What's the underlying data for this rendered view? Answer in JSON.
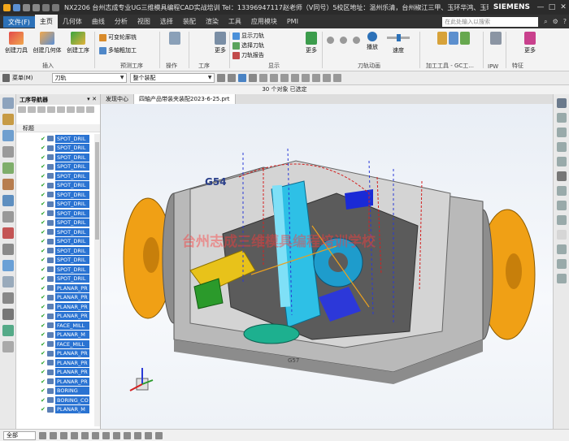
{
  "titlebar": {
    "title": "NX2206 台州志成专业UG三维模具编程CAD实战培训 Tel：13396947117赵老师（V同号）5校区地址：温州乐清，台州椒江三甲、玉环华鸿、玉环沙门，玉环坎门 - 加工",
    "brand": "SIEMENS",
    "minimize": "—",
    "maximize": "□",
    "close": "✕"
  },
  "menubar": {
    "file": "文件(F)",
    "items": [
      "主页",
      "几何体",
      "曲线",
      "分析",
      "视图",
      "选择",
      "装配",
      "渲染",
      "工具",
      "应用模块",
      "PMI"
    ],
    "active_index": 0,
    "search_placeholder": "在此处输入以搜索"
  },
  "ribbon": {
    "buttons": {
      "create_tool": "创建刀具",
      "create_geometry": "创建几何体",
      "create_operation": "创建工序",
      "variable_profile": "可变轮廓铣",
      "multiaxis_rough": "多轴粗加工",
      "more1": "更多",
      "more2": "更多",
      "show_path": "显示刀轨",
      "select_path": "选择刀轨",
      "path_report": "刀轨报告",
      "more3": "更多",
      "play": "播放",
      "speed": "速度",
      "machining_tools": "加工工具 - GC工...",
      "more4": "更多"
    },
    "groups": [
      "插入",
      "预测工序",
      "操作",
      "工序",
      "显示",
      "刀轨动画",
      "加工工具 - GC工...",
      "IPW",
      "特征"
    ]
  },
  "selbar": {
    "menu": "菜单(M)",
    "filter": "刀轨",
    "scope": "整个装配"
  },
  "status": "30 个对象 已选定",
  "navigator": {
    "title": "工序导航器",
    "column": "标题",
    "rows": [
      "SPOT_DRIL",
      "SPOT_DRIL",
      "SPOT_DRIL",
      "SPOT_DRIL",
      "SPOT_DRIL",
      "SPOT_DRIL",
      "SPOT_DRIL",
      "SPOT_DRIL",
      "SPOT_DRIL",
      "SPOT_DRIL",
      "SPOT_DRIL",
      "SPOT_DRIL",
      "SPOT_DRIL",
      "SPOT_DRIL",
      "SPOT_DRIL",
      "SPOT_DRIL",
      "PLANAR_PR",
      "PLANAR_PR",
      "PLANAR_PR",
      "PLANAR_PR",
      "FACE_MILL",
      "PLANAR_M",
      "FACE_MILL",
      "PLANAR_PR",
      "PLANAR_PR",
      "PLANAR_PR",
      "PLANAR_PR",
      "BORING",
      "BORING_CO",
      "PLANAR_M"
    ]
  },
  "tabs": {
    "discovery": "发现中心",
    "file": "四轴产品带装夹装配2023-6-25.prt"
  },
  "viewport": {
    "wcs_label": "G54",
    "watermark": "台州志成三维模具编程培训学校",
    "part_marking": "G57"
  },
  "bottombar": {
    "filter": "全部"
  }
}
